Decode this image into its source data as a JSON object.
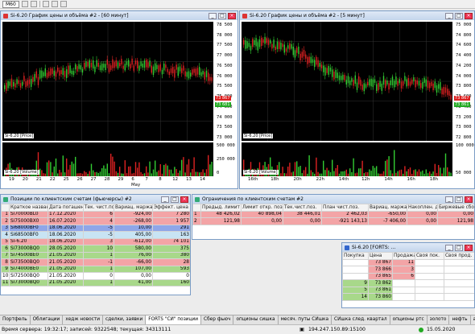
{
  "toolbar": {
    "timeframe": "M60"
  },
  "win1": {
    "title": "Si-6.20 График цены и объёма #2 - [60 минут]",
    "price_label": "Si-6.20 [Price]",
    "volume_label": "Si-6.20 [Volume]",
    "y_ticks": [
      "78 500",
      "78 000",
      "77 500",
      "77 000",
      "76 500",
      "76 000",
      "75 500",
      "75 000",
      "74 500",
      "74 000",
      "73 500",
      "73 000"
    ],
    "x_ticks": [
      "19",
      "20",
      "21",
      "22",
      "25",
      "26",
      "27",
      "28",
      "29",
      "6",
      "7",
      "8",
      "12",
      "13",
      "14"
    ],
    "month": "May",
    "price_tags": [
      "73 867",
      "73 681"
    ],
    "vol_ticks": [
      "500 000",
      "250 000",
      "0"
    ]
  },
  "win2": {
    "title": "Si-6.20 График цены и объёма #2 - [5 минут]",
    "price_label": "Si-6.20 [Price]",
    "volume_label": "Si-6.20 [Volume]",
    "y_ticks": [
      "75 000",
      "74 800",
      "74 600",
      "74 400",
      "74 200",
      "74 000",
      "73 800",
      "73 600",
      "73 400",
      "73 200",
      "73 000",
      "72 800"
    ],
    "x_ticks": [
      "16th",
      "18h",
      "20h",
      "22h",
      "14th",
      "12h",
      "14h",
      "16h",
      "18h"
    ],
    "price_tags": [
      "73 867",
      "73 861"
    ],
    "vol_ticks": [
      "100 000",
      "50 000"
    ]
  },
  "positions": {
    "title": "Позиции по клиентским счетам (фьючерсы) #2",
    "headers": [
      "",
      "Краткое название",
      "Дата погашения",
      "Тек. чист.поз.",
      "Вариац. маржа",
      "Эффект. цена"
    ],
    "rows": [
      {
        "n": "1",
        "name": "Si70000BL0",
        "date": "17.12.2020",
        "qty": "6",
        "vm": "-924,00",
        "px": "7 280",
        "cls": "r"
      },
      {
        "n": "2",
        "name": "Si75000BX0",
        "date": "16.07.2020",
        "qty": "4",
        "vm": "-268,00",
        "px": "1 957",
        "cls": "r"
      },
      {
        "n": "3",
        "name": "Si68000BF0",
        "date": "18.06.2020",
        "qty": "-5",
        "vm": "10,00",
        "px": "291",
        "cls": "b"
      },
      {
        "n": "4",
        "name": "Si68500BF0",
        "date": "18.06.2020",
        "qty": "-5",
        "vm": "405,00",
        "px": "163",
        "cls": "bl"
      },
      {
        "n": "5",
        "name": "Si-6.20",
        "date": "18.06.2020",
        "qty": "3",
        "vm": "-612,00",
        "px": "74 101",
        "cls": "r"
      },
      {
        "n": "6",
        "name": "Si73000BQ0",
        "date": "28.05.2020",
        "qty": "10",
        "vm": "580,00",
        "px": "375",
        "cls": "g"
      },
      {
        "n": "7",
        "name": "Si74500BE0",
        "date": "21.05.2020",
        "qty": "1",
        "vm": "76,00",
        "px": "380",
        "cls": "g"
      },
      {
        "n": "8",
        "name": "Si73500BQ0",
        "date": "21.05.2020",
        "qty": "-1",
        "vm": "-66,00",
        "px": "28",
        "cls": "r"
      },
      {
        "n": "9",
        "name": "Si74000BE0",
        "date": "21.05.2020",
        "qty": "1",
        "vm": "107,00",
        "px": "593",
        "cls": "g"
      },
      {
        "n": "10",
        "name": "Si72500BQ0",
        "date": "21.05.2020",
        "qty": "0",
        "vm": "0,00",
        "px": "0",
        "cls": "w"
      },
      {
        "n": "11",
        "name": "Si73000BQ0",
        "date": "21.05.2020",
        "qty": "1",
        "vm": "41,00",
        "px": "160",
        "cls": "g"
      }
    ]
  },
  "limits": {
    "title": "Ограничения по клиентским счетам #2",
    "headers": [
      "",
      "Предыд. лимит",
      "Лимит откр. поз.",
      "Тек.чист.поз.",
      "План чист.поз.",
      "Вариац. маржа",
      "Накоплен. доход",
      "Биржевые сборы"
    ],
    "rows": [
      {
        "n": "1",
        "a": "48 426,02",
        "b": "40 898,04",
        "c": "38 446,01",
        "d": "2 462,03",
        "e": "-650,00",
        "f": "0,00",
        "g": "0,00",
        "cls": "r"
      },
      {
        "n": "2",
        "a": "121,98",
        "b": "0,00",
        "c": "0,00",
        "d": "-921 143,13",
        "e": "-7 406,00",
        "f": "0,00",
        "g": "121,98",
        "cls": "r"
      }
    ]
  },
  "depth": {
    "title": "Si-6.20 [FORTS: ...",
    "headers": [
      "Покупка",
      "Цена",
      "Продажа",
      "Своя пок.",
      "Своя прод."
    ],
    "rows": [
      {
        "buy": "",
        "price": "73 867",
        "sell": "11",
        "cls": "r"
      },
      {
        "buy": "",
        "price": "73 866",
        "sell": "3",
        "cls": "r"
      },
      {
        "buy": "",
        "price": "73 865",
        "sell": "6",
        "cls": "r"
      },
      {
        "buy": "9",
        "price": "73 862",
        "sell": "",
        "cls": "g"
      },
      {
        "buy": "5",
        "price": "73 861",
        "sell": "",
        "cls": "g"
      },
      {
        "buy": "14",
        "price": "73 860",
        "sell": "",
        "cls": "g"
      }
    ]
  },
  "tabs": [
    "Портфель",
    "Облигации",
    "хедж новости",
    "сделки, заявки",
    "FORTS \"СИ\" позиции",
    "Сбер фьюч",
    "опционы сишка",
    "месяч. путы СИшка",
    "СИшка след. квартал",
    "опционы ртс",
    "золото",
    "нефть",
    "аналю",
    "офз фьючерсы"
  ],
  "active_tab": 4,
  "status": {
    "server_time": "Время сервера: 19:32:17; записей: 9322548; текущая: 34313111",
    "ip": "194.247.150.89:15100",
    "date": "15.05.2020"
  }
}
